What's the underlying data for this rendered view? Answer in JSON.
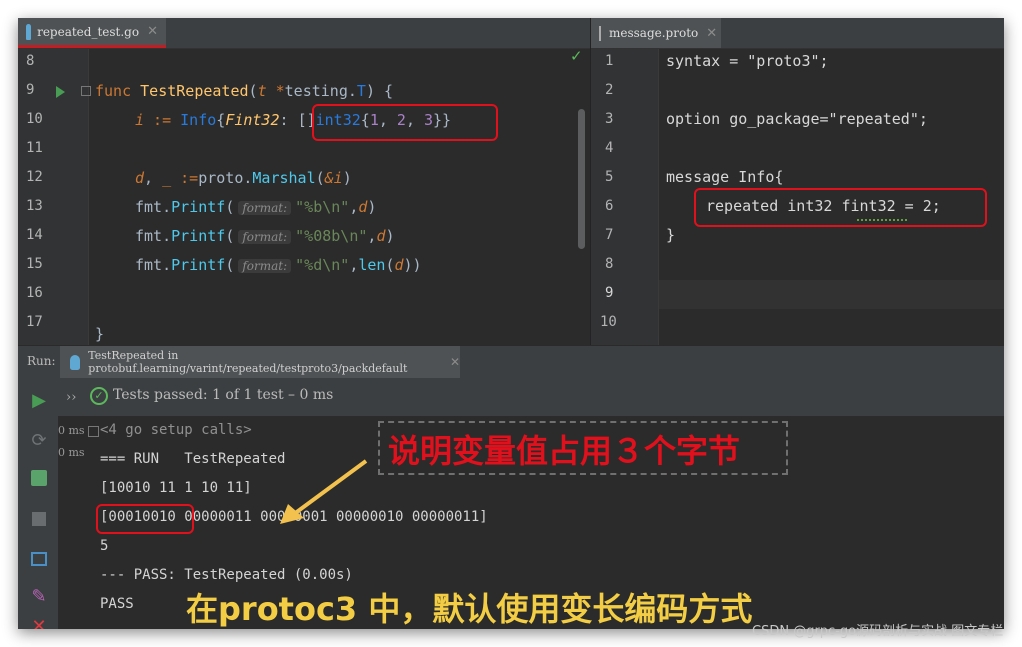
{
  "left_editor": {
    "tab_label": "repeated_test.go",
    "line_numbers": [
      "8",
      "9",
      "10",
      "11",
      "12",
      "13",
      "14",
      "15",
      "16",
      "17"
    ],
    "param_hint": "format:",
    "code": {
      "l9_kw": "func",
      "l9_fn": "TestRepeated",
      "l9_open": "(",
      "l9_t": "t",
      "l9_star": " *",
      "l9_pkg": "testing.",
      "l9_T": "T",
      "l9_close": ") {",
      "l10_i": "i",
      "l10_op": " := ",
      "l10_type": "Info",
      "l10_brace": "{",
      "l10_field": "Fint32",
      "l10_colon": ": ",
      "l10_slice": "[]",
      "l10_int": "int32",
      "l10_b1": "{",
      "l10_n1": "1",
      "l10_c1": ", ",
      "l10_n2": "2",
      "l10_c2": ", ",
      "l10_n3": "3",
      "l10_end": "}}",
      "l12_d": "d",
      "l12_comma": ", ",
      "l12_us": "_",
      "l12_op": " :=",
      "l12_pkg": "proto.",
      "l12_fn": "Marshal",
      "l12_open": "(",
      "l12_amp": "&i",
      "l12_close": ")",
      "fmt": "fmt.",
      "printf": "Printf",
      "open": "(",
      "l13_str": "\"%b\\n\"",
      "l14_str": "\"%08b\\n\"",
      "l15_str": "\"%d\\n\"",
      "comma": ",",
      "d": "d",
      "close": ")",
      "len": "len",
      "l15_close": "))",
      "l17": "}"
    }
  },
  "right_editor": {
    "tab_label": "message.proto",
    "line_numbers": [
      "1",
      "2",
      "3",
      "4",
      "5",
      "6",
      "7",
      "8",
      "9",
      "10"
    ],
    "lines": {
      "l1": "syntax = \"proto3\";",
      "l3": "option go_package=\"repeated\";",
      "l5": "message Info{",
      "l6": "repeated int32 fint32 = 2;",
      "l7": "}"
    }
  },
  "run_panel": {
    "run_label": "Run:",
    "config_label": "TestRepeated in protobuf.learning/varint/repeated/testproto3/packdefault",
    "status": "Tests passed: 1 of 1 test – 0 ms",
    "time_badges": [
      "0 ms",
      "0 ms"
    ],
    "chevron": "››",
    "output_lines": [
      "<4 go setup calls>",
      "=== RUN   TestRepeated",
      "[10010 11 1 10 11]",
      "[00010010 00000011 00000001 00000010 00000011]",
      "5",
      "--- PASS: TestRepeated (0.00s)",
      "PASS"
    ]
  },
  "annotations": {
    "callout": "说明变量值占用３个字节",
    "bottom_note": "在protoc3 中，默认使用变长编码方式"
  },
  "watermark": "CSDN @grpc-go源码剖析与实战 图文专栏",
  "colors": {
    "annotation_red": "#e0101c",
    "arrow_yellow": "#f2c14e",
    "note_yellow": "#f3cd43"
  }
}
